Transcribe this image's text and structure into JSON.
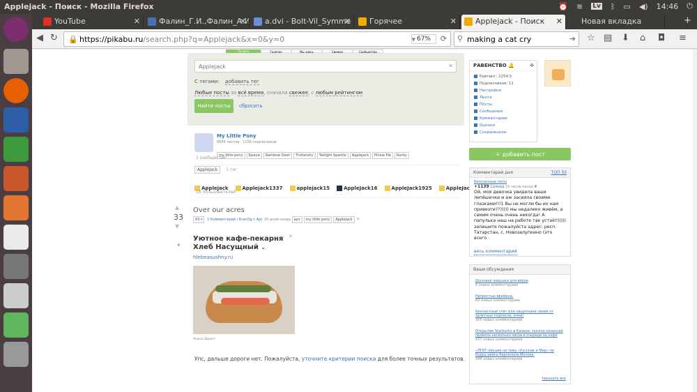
{
  "window": {
    "title": "Applejack - Поиск - Mozilla Firefox",
    "time": "14:46",
    "kb": "Lv"
  },
  "tabs": [
    {
      "label": "YouTube",
      "color": "#e52d27"
    },
    {
      "label": "Фалин_Г.И.,Фалин_А.И",
      "color": "#4a6fb5"
    },
    {
      "label": "a.dvi - Bolt-Vil_Symme",
      "color": "#6a8fd5"
    },
    {
      "label": "Горячее",
      "color": "#f2a900"
    },
    {
      "label": "Applejack - Поиск",
      "color": "#f2a900"
    },
    {
      "label": "Новая вкладка",
      "color": ""
    }
  ],
  "nav": {
    "url_host": "https://pikabu.ru",
    "url_path": "/search.php?q=Applejack&x=0&y=0",
    "zoom": "67%",
    "search": "making a cat cry"
  },
  "top_tabs": [
    "Лучшее",
    "Горячее",
    "Мы здесь",
    "Свежее",
    "Сообщества"
  ],
  "search": {
    "query": "Applejack",
    "tags_label": "С тегами:",
    "add_tag": "добавить тег",
    "filter": {
      "any": "Любые посты",
      "for": "за",
      "period": "всё время",
      "first": ", сначала",
      "sort": "свежее",
      "with": ", с",
      "rating": "любым рейтингом"
    },
    "find_btn": "Найти посты",
    "reset": "сбросить"
  },
  "community": {
    "name": "My Little Pony",
    "meta": "8689 постов · 1158 подписчиков",
    "tags": [
      "my little pony",
      "Брони",
      "Rainbow Dash",
      "Fluttershy",
      "Twilight Sparkle",
      "Applejack",
      "Pinkie Pie",
      "Rarity"
    ],
    "count": "1 сообщество"
  },
  "tag_result": {
    "tag": "AppleJack",
    "count": "1 тег"
  },
  "users": {
    "list": [
      "Applejack",
      "Applejack1337",
      "applejack15",
      "AppleJack16",
      "AppleJack1925",
      "AppleJack198"
    ],
    "count": "18 пользователей"
  },
  "post": {
    "title": "Over our acres",
    "rating": "33",
    "badge": "69",
    "comments": "1 Комментарий",
    "author": "KranOg",
    "in": "в",
    "section": "Арт",
    "time": "10 дней назад",
    "tags": [
      "арт",
      "my little pony",
      "Applejack"
    ]
  },
  "ad": {
    "title": "Уютное кафе-пекарня Хлеб Насущный",
    "url": "hlebnasushny.ru",
    "source": "Яндекс.Директ"
  },
  "end_msg": {
    "pre": "Упс, дальше дороги нет. Пожалуйста,",
    "link": "уточните критерии поиска",
    "post": "для более точных результатов."
  },
  "sidebar": {
    "rating_title": "РАВЕНСТВО",
    "items": [
      "Рейтинг: 2254.5",
      "Подписчиков: 11",
      "Настройки",
      "Лента",
      "Посты",
      "Сообщения",
      "Комментарии",
      "Оценки",
      "Сохраненное"
    ],
    "add_post": "добавить пост",
    "comment_day": {
      "title": "Комментарий дня",
      "top": "ТОП 50",
      "post_link": "Бесплатные питы",
      "score": "+1139",
      "author": "Салмад",
      "time": "15 часов назад",
      "text": "Ой, моя девочка увидела ваши лепёшечки и аж засияла своими глазками!!!1 Вы не могли бы их нам привезти??))))) мы недалеко живём, а самим очень очень некогда! А папулька наш на работе так устаёт))))) запишите пожалуйста адрес: респ. Татарстан, с. Новозалупкино (это всего",
      "all": "весь комментарий"
    },
    "discussions": {
      "title": "Ваши обсуждения",
      "items": [
        {
          "t": "Шуховая ловушка для воров",
          "c": "6 новых комментариев"
        },
        {
          "t": "Непростые времена.",
          "c": "69 новых комментариев"
        },
        {
          "t": "Кентактный счёт или защитники своей от залетных подписок, ёлки!",
          "c": "305 новых комментариев"
        },
        {
          "t": "Открытие Starbucks в Казани: тысяча казанцев провела несколько часов в очереди за кофе",
          "c": "107 новых комментариев"
        },
        {
          "t": "«ЛГБТ-лекция на тему «Русские и Мир» по бодру рейса Барселона-Москва.",
          "c": "348 новых комментариев"
        }
      ],
      "show_all": "показать все"
    }
  }
}
